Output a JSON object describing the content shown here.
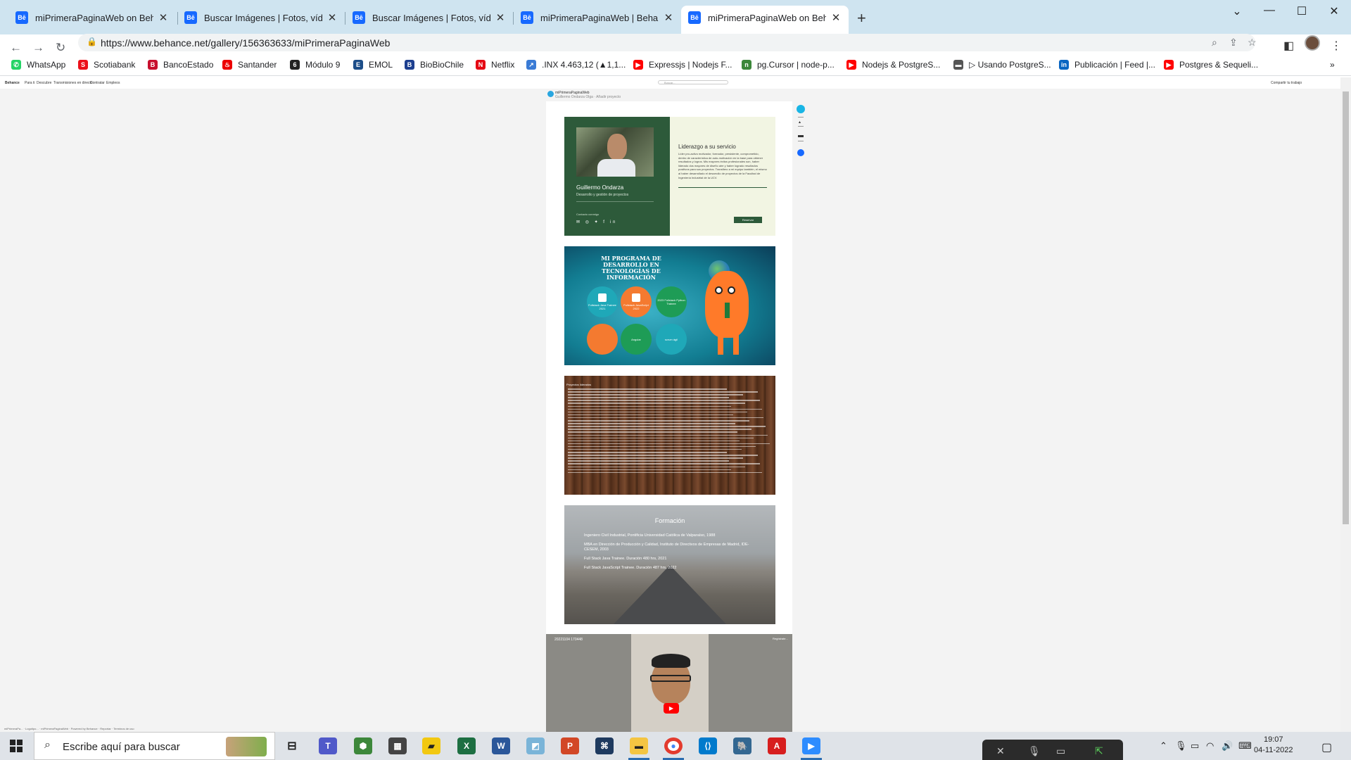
{
  "browser": {
    "tabs": [
      {
        "title": "miPrimeraPaginaWeb on Behance",
        "favicon": "Bē"
      },
      {
        "title": "Buscar Imágenes | Fotos, vídeos,",
        "favicon": "Bē"
      },
      {
        "title": "Buscar Imágenes | Fotos, vídeos,",
        "favicon": "Bē"
      },
      {
        "title": "miPrimeraPaginaWeb | Behance",
        "favicon": "Bē"
      },
      {
        "title": "miPrimeraPaginaWeb on Behance",
        "favicon": "Bē"
      }
    ],
    "active_tab_index": 4,
    "url": "https://www.behance.net/gallery/156363633/miPrimeraPaginaWeb",
    "bookmarks": [
      {
        "label": "WhatsApp",
        "color": "#25d366",
        "glyph": "✆"
      },
      {
        "label": "Scotiabank",
        "color": "#ec111a",
        "glyph": "S"
      },
      {
        "label": "BancoEstado",
        "color": "#c8102e",
        "glyph": "B"
      },
      {
        "label": "Santander",
        "color": "#ec0000",
        "glyph": "♨"
      },
      {
        "label": "Módulo 9",
        "color": "#222222",
        "glyph": "6"
      },
      {
        "label": "EMOL",
        "color": "#1d4e89",
        "glyph": "E"
      },
      {
        "label": "BioBioChile",
        "color": "#1d3f8f",
        "glyph": "B"
      },
      {
        "label": "Netflix",
        "color": "#e50914",
        "glyph": "N"
      },
      {
        "label": ".INX 4.463,12 (▲1,1...",
        "color": "#3a7bd5",
        "glyph": "↗"
      },
      {
        "label": "Expressjs | Nodejs F...",
        "color": "#ff0000",
        "glyph": "▶"
      },
      {
        "label": "pg.Cursor | node-p...",
        "color": "#3c873a",
        "glyph": "n"
      },
      {
        "label": "Nodejs & PostgreS...",
        "color": "#ff0000",
        "glyph": "▶"
      },
      {
        "label": "▷ Usando PostgreS...",
        "color": "#555555",
        "glyph": "▬"
      },
      {
        "label": "Publicación | Feed |...",
        "color": "#0a66c2",
        "glyph": "in"
      },
      {
        "label": "Postgres & Sequeli...",
        "color": "#ff0000",
        "glyph": "▶"
      }
    ]
  },
  "behance": {
    "nav": [
      "Behance",
      "Para ti",
      "Descubre",
      "Transmisiones en directo",
      "Contratar",
      "Empleos"
    ],
    "search_placeholder": "Buscar...",
    "project_title": "miPrimeraPaginaWeb",
    "project_sub": "Guillermo Ondarza Olga  ·  Añadir proyecto",
    "right_button": "Compartir tu trabajo"
  },
  "card1": {
    "name": "Guillermo Ondarza",
    "role": "Desarrollo y gestión de proyectos",
    "contact_label": "Contacto conmigo",
    "socials": "✉ ◎ ✦ f in",
    "right_title": "Liderazgo a su servicio",
    "right_text": "Líder pro-activo motivador, formador, persistente, comprometido, dentro de característica de auto-motivación en la base para obtener resultados y logros. Mis mayores éxitos profesionales son, haber liderado dos mayores de diseño aire y haber logrado resultados positivos para sus proyectos. Transfiero a mi equipo también, el mismo al haber desarrollado el desarrollo de proyectos de la Facultad de Ingeniería Industrial de la UCV.",
    "button": "Reservar"
  },
  "card2": {
    "title": "MI PROGRAMA DE DESARROLLO EN TECNOLOGÍAS DE INFORMACIÓN",
    "circles": [
      {
        "label": "Fullstack Java Trainee 2021",
        "color": "#1fa8b8"
      },
      {
        "label": "Fullstack JavaScript 2022",
        "color": "#f47a30"
      },
      {
        "label": "2023 Fullstack Python Trainee",
        "color": "#1e9c56"
      },
      {
        "label": "",
        "color": "#f47a30"
      },
      {
        "label": "Angular",
        "color": "#1e9c56"
      },
      {
        "label": "scrum ágil",
        "color": "#1fa8b8"
      }
    ]
  },
  "card3": {
    "title": "Proyectos liderados",
    "line_count": 30
  },
  "card4": {
    "title": "Formación",
    "items": [
      "Ingeniero Civil Industrial, Pontificia Universidad Católica de Valparaíso, 1988",
      "MBA en Dirección de Producción y Calidad, Instituto de Directivos de Empresas de Madrid, IDE-CESEM, 2003",
      "Full Stack Java Trainee. Duración 480 hrs, 2021",
      "Full Stack JavaScript Trainee. Duración 487 hrs, 2022"
    ]
  },
  "video": {
    "title": "20221104 170448",
    "channel": "Regístrate..."
  },
  "footer": "miPrimeraPa...   ·   Logotipo...   ·   miPrimeraPaginaWeb   ·   Powered by Behance   ·   Reportar   ·   Terminos de uso",
  "taskbar": {
    "search_placeholder": "Escribe aquí para buscar",
    "time": "19:07",
    "date": "04-11-2022"
  },
  "colors": {
    "tabstrip": "#cfe4f0",
    "behance_blue": "#1769ff",
    "card1_green": "#2d5a3a"
  }
}
